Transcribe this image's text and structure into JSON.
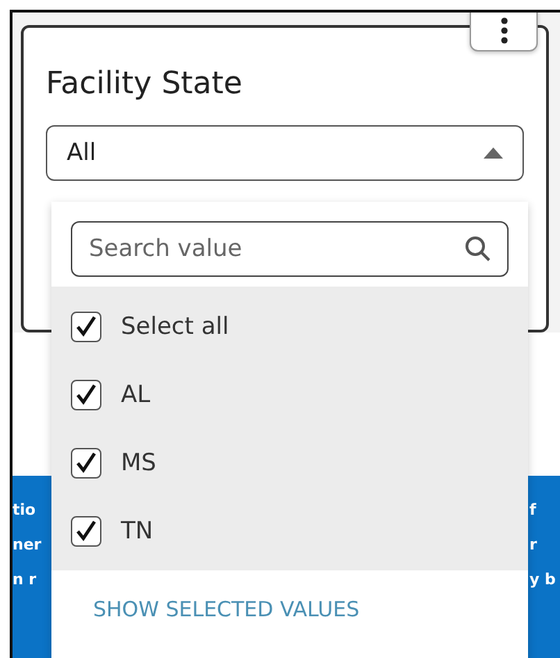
{
  "card": {
    "title": "Facility State",
    "select": {
      "value": "All",
      "expanded": true
    }
  },
  "dropdown": {
    "search": {
      "placeholder": "Search value"
    },
    "options": [
      {
        "label": "Select all",
        "checked": true
      },
      {
        "label": "AL",
        "checked": true
      },
      {
        "label": "MS",
        "checked": true
      },
      {
        "label": "TN",
        "checked": true
      }
    ],
    "footer_link": "SHOW SELECTED VALUES"
  },
  "background_text": {
    "left": [
      "tio",
      "ner",
      "n r"
    ],
    "right": [
      "f",
      "r",
      "y b"
    ]
  }
}
